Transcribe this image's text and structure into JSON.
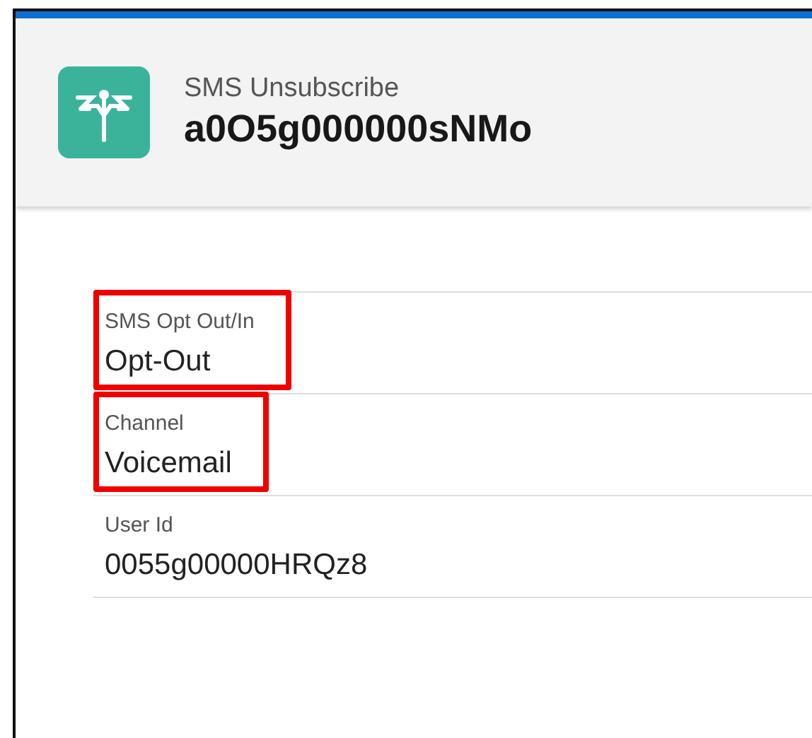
{
  "header": {
    "object_type": "SMS Unsubscribe",
    "record_name": "a0O5g000000sNMo"
  },
  "fields": [
    {
      "label": "SMS Opt Out/In",
      "value": "Opt-Out",
      "highlighted": true
    },
    {
      "label": "Channel",
      "value": "Voicemail",
      "highlighted": true
    },
    {
      "label": "User Id",
      "value": "0055g00000HRQz8",
      "highlighted": false
    }
  ]
}
